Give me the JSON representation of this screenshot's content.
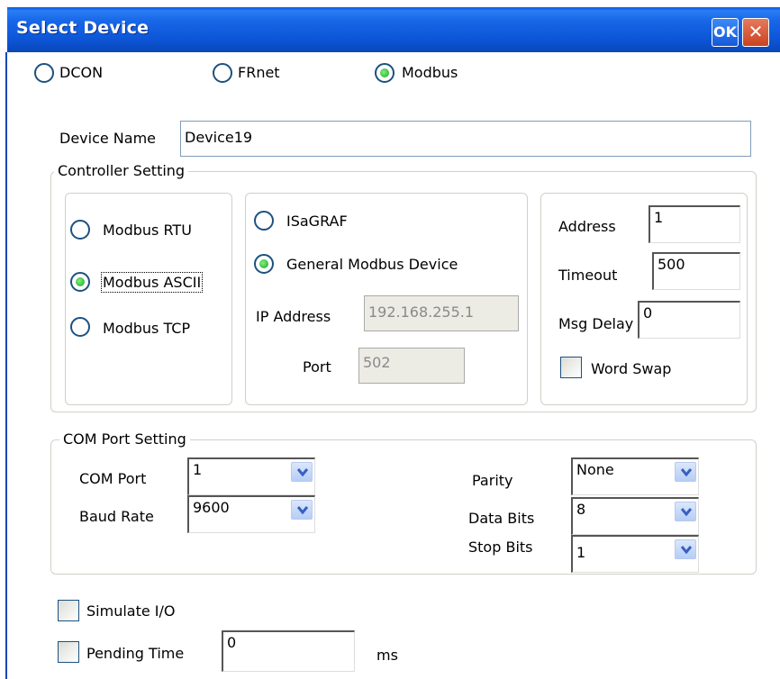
{
  "window": {
    "title": "Select Device",
    "ok_label": "OK",
    "close_label": "✕"
  },
  "protocol": {
    "options": [
      "DCON",
      "FRnet",
      "Modbus"
    ],
    "selected": "Modbus"
  },
  "device_name": {
    "label": "Device Name",
    "value": "Device19"
  },
  "controller_setting": {
    "label": "Controller Setting",
    "modbus_types": [
      "Modbus RTU",
      "Modbus ASCII",
      "Modbus TCP"
    ],
    "modbus_selected": "Modbus ASCII",
    "device_types": [
      "ISaGRAF",
      "General Modbus Device"
    ],
    "device_selected": "General Modbus Device",
    "ip_address": {
      "label": "IP Address",
      "value": "192.168.255.1"
    },
    "port": {
      "label": "Port",
      "value": "502"
    },
    "address": {
      "label": "Address",
      "value": "1"
    },
    "timeout": {
      "label": "Timeout",
      "value": "500"
    },
    "msg_delay": {
      "label": "Msg Delay",
      "value": "0"
    },
    "word_swap": {
      "label": "Word Swap",
      "checked": false
    }
  },
  "com_port_setting": {
    "label": "COM Port Setting",
    "com_port": {
      "label": "COM Port",
      "value": "1"
    },
    "baud_rate": {
      "label": "Baud Rate",
      "value": "9600"
    },
    "parity": {
      "label": "Parity",
      "value": "None"
    },
    "data_bits": {
      "label": "Data Bits",
      "value": "8"
    },
    "stop_bits": {
      "label": "Stop Bits",
      "value": "1"
    }
  },
  "simulate_io": {
    "label": "Simulate I/O",
    "checked": false
  },
  "pending_time": {
    "label": "Pending Time",
    "value": "0",
    "unit": "ms",
    "checked": false
  }
}
